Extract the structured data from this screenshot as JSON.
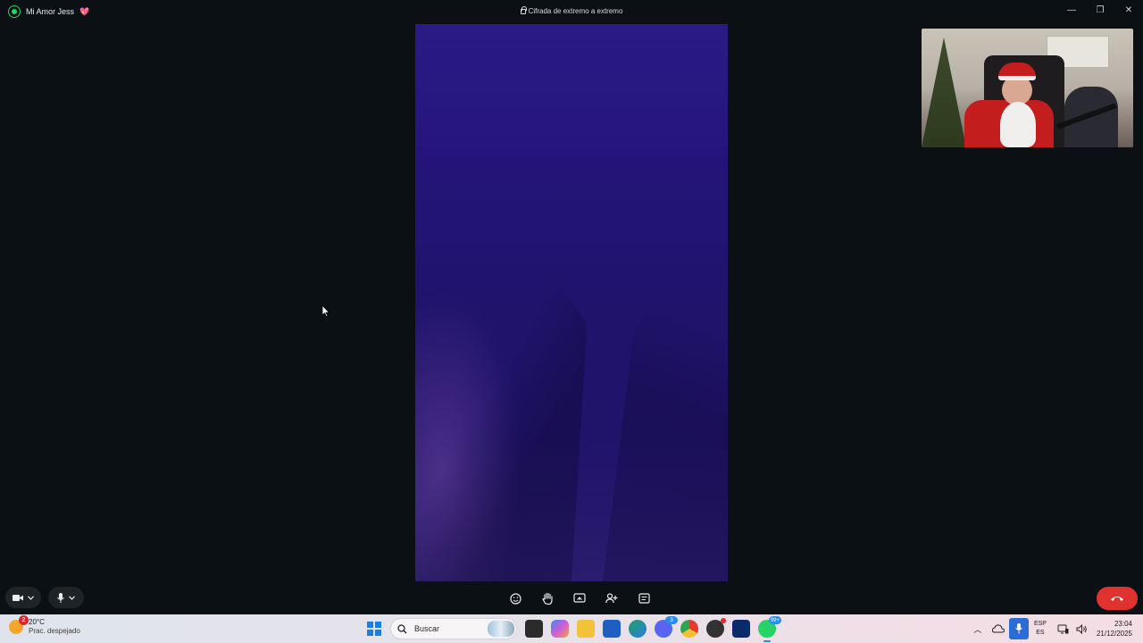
{
  "window": {
    "contact_name": "Mi Amor Jess",
    "heart_emoji": "💖",
    "encryption_text": "Cifrada de extremo a extremo",
    "minimize_label": "—",
    "maximize_label": "❐",
    "close_label": "✕"
  },
  "call_controls": {
    "video_label": "video",
    "mic_label": "microphone",
    "buttons": [
      "emoji-reactions",
      "raise-hand",
      "share-screen",
      "add-participant",
      "captions"
    ]
  },
  "colors": {
    "end_call": "#e0332f",
    "app_background": "#0b1014",
    "whatsapp_green": "#25d366"
  },
  "taskbar": {
    "weather_badge": "2",
    "temperature": "20°C",
    "weather_desc": "Prac. despejado",
    "search_placeholder": "Buscar",
    "whatsapp_badge": "99+",
    "discord_badge": "3",
    "lang_top": "ESP",
    "lang_bottom": "ES",
    "time": "23:04",
    "date": "21/12/2025"
  }
}
